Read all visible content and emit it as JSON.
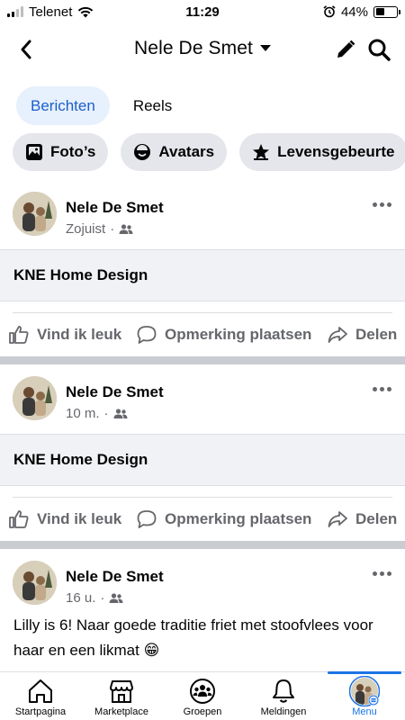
{
  "status_bar": {
    "carrier": "Telenet",
    "time": "11:29",
    "battery": "44%",
    "battery_level": 0.44
  },
  "header": {
    "title": "Nele De Smet"
  },
  "tabs": [
    {
      "label": "Berichten",
      "active": true
    },
    {
      "label": "Reels",
      "active": false
    }
  ],
  "chips": [
    {
      "label": "Foto’s",
      "icon": "photos-icon"
    },
    {
      "label": "Avatars",
      "icon": "avatar-icon"
    },
    {
      "label": "Levensgebeurte",
      "icon": "life-event-icon"
    }
  ],
  "posts": [
    {
      "author": "Nele De Smet",
      "time": "Zojuist",
      "audience": "friends-icon",
      "link_title": "KNE Home Design",
      "actions": {
        "like": "Vind ik leuk",
        "comment": "Opmerking plaatsen",
        "share": "Delen"
      }
    },
    {
      "author": "Nele De Smet",
      "time": "10 m.",
      "audience": "friends-icon",
      "link_title": "KNE Home Design",
      "actions": {
        "like": "Vind ik leuk",
        "comment": "Opmerking plaatsen",
        "share": "Delen"
      }
    },
    {
      "author": "Nele De Smet",
      "time": "16 u.",
      "audience": "friends-icon",
      "text": "Lilly is 6! Naar goede traditie friet met stoofvlees voor haar en een likmat 😁"
    }
  ],
  "bottom_nav": [
    {
      "label": "Startpagina",
      "icon": "home-icon"
    },
    {
      "label": "Marketplace",
      "icon": "marketplace-icon"
    },
    {
      "label": "Groepen",
      "icon": "groups-icon"
    },
    {
      "label": "Meldingen",
      "icon": "bell-icon"
    },
    {
      "label": "Menu",
      "icon": "menu-avatar-icon",
      "active": true
    }
  ],
  "colors": {
    "accent": "#1b74e4",
    "tab_active_bg": "#e7f0fd",
    "chip_bg": "#e4e6eb",
    "separator": "#c9ccd1",
    "meta": "#65676b"
  }
}
